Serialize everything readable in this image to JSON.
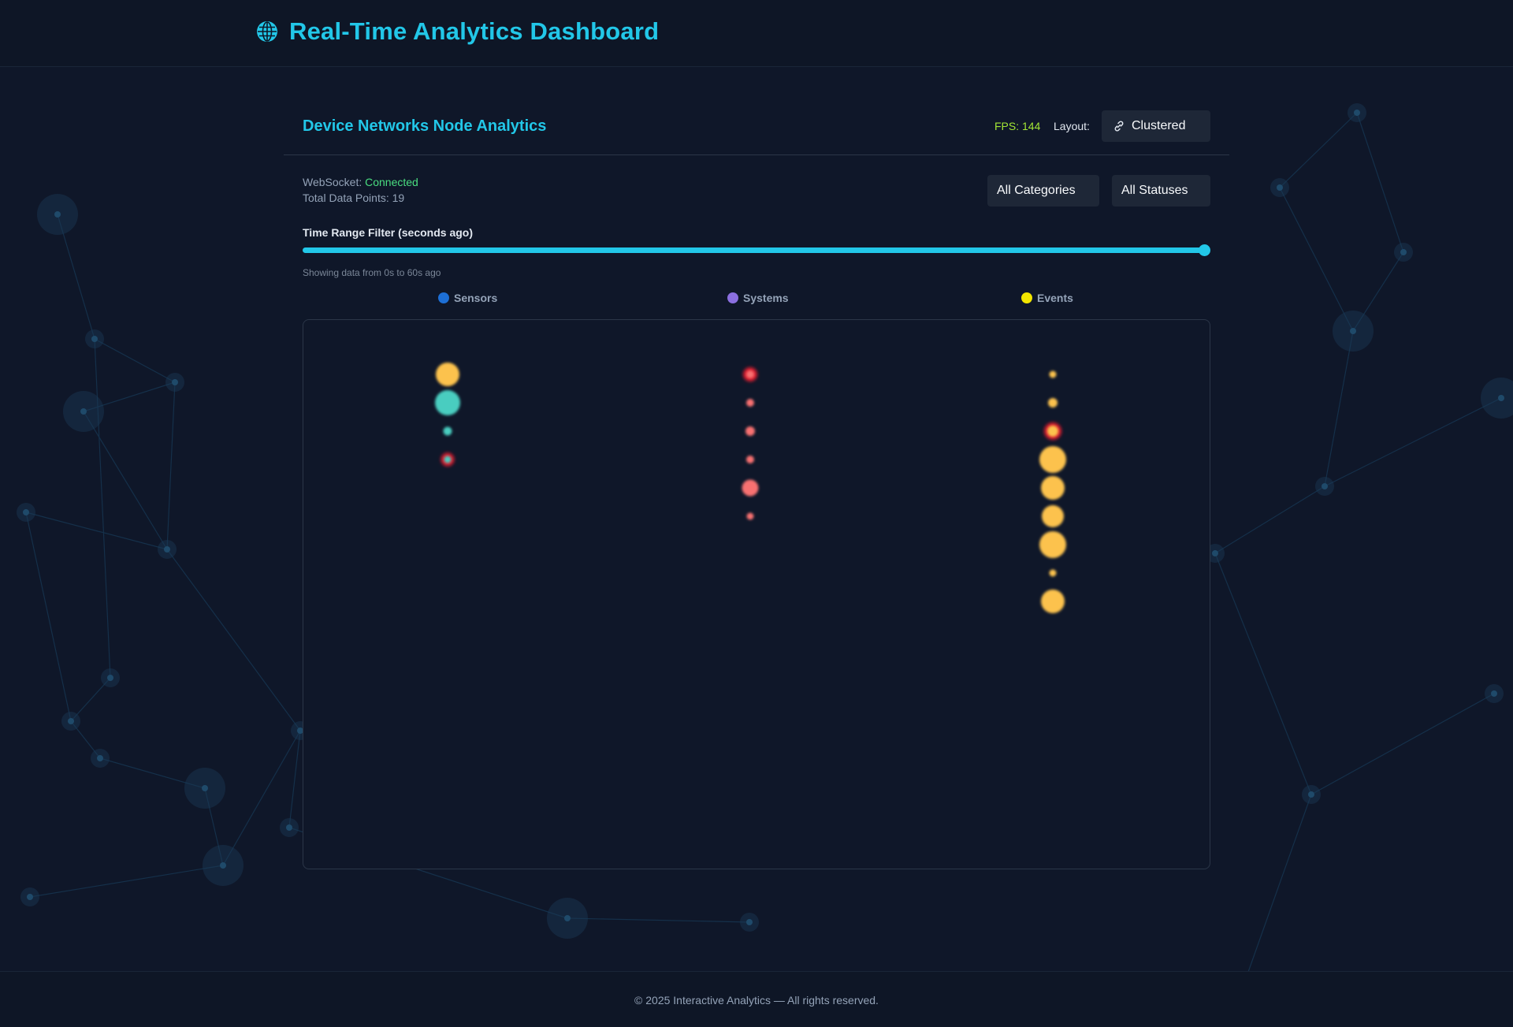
{
  "app": {
    "title": "Real-Time Analytics Dashboard",
    "icon": "globe-icon",
    "accent": "#22c7e8"
  },
  "panel": {
    "title": "Device Networks Node Analytics",
    "fps": "FPS: 144",
    "layout_label": "Layout:",
    "layout_value": "Clustered",
    "layout_icon": "link-icon"
  },
  "status": {
    "websocket_label": "WebSocket: ",
    "websocket_value": "Connected",
    "total_points": "Total Data Points: 19"
  },
  "filters": {
    "category": "All Categories",
    "status": "All Statuses",
    "range_label": "Time Range Filter (seconds ago)",
    "range_value": [
      0,
      60
    ],
    "range_caption": "Showing data from 0s to 60s ago"
  },
  "legend": [
    {
      "label": "Sensors",
      "color": "#1d6fd6"
    },
    {
      "label": "Systems",
      "color": "#8b6fe0"
    },
    {
      "label": "Events",
      "color": "#f2e600"
    }
  ],
  "chart_data": {
    "type": "scatter",
    "columns": [
      "Sensors",
      "Systems",
      "Events"
    ],
    "nodes": [
      {
        "column": "Sensors",
        "row": 0,
        "size": 30,
        "color": "#fcc24d",
        "alert": false
      },
      {
        "column": "Sensors",
        "row": 1,
        "size": 32,
        "color": "#48cdc0",
        "alert": false
      },
      {
        "column": "Sensors",
        "row": 2,
        "size": 11,
        "color": "#48cdc0",
        "alert": false
      },
      {
        "column": "Sensors",
        "row": 3,
        "size": 9,
        "color": "#48cdc0",
        "alert": true
      },
      {
        "column": "Systems",
        "row": 0,
        "size": 10,
        "color": "#f87171",
        "alert": true
      },
      {
        "column": "Systems",
        "row": 1,
        "size": 10,
        "color": "#f87171",
        "alert": false
      },
      {
        "column": "Systems",
        "row": 2,
        "size": 12,
        "color": "#f87171",
        "alert": false
      },
      {
        "column": "Systems",
        "row": 3,
        "size": 10,
        "color": "#f87171",
        "alert": false
      },
      {
        "column": "Systems",
        "row": 4,
        "size": 21,
        "color": "#f87171",
        "alert": false
      },
      {
        "column": "Systems",
        "row": 5,
        "size": 9,
        "color": "#f87171",
        "alert": false
      },
      {
        "column": "Events",
        "row": 0,
        "size": 9,
        "color": "#fcc24d",
        "alert": false
      },
      {
        "column": "Events",
        "row": 1,
        "size": 12,
        "color": "#fcc24d",
        "alert": false
      },
      {
        "column": "Events",
        "row": 2,
        "size": 14,
        "color": "#fcc24d",
        "alert": true
      },
      {
        "column": "Events",
        "row": 3,
        "size": 34,
        "color": "#fcc24d",
        "alert": false
      },
      {
        "column": "Events",
        "row": 4,
        "size": 30,
        "color": "#fcc24d",
        "alert": false
      },
      {
        "column": "Events",
        "row": 5,
        "size": 28,
        "color": "#fcc24d",
        "alert": false
      },
      {
        "column": "Events",
        "row": 6,
        "size": 34,
        "color": "#fcc24d",
        "alert": false
      },
      {
        "column": "Events",
        "row": 7,
        "size": 9,
        "color": "#fcc24d",
        "alert": false
      },
      {
        "column": "Events",
        "row": 8,
        "size": 30,
        "color": "#fcc24d",
        "alert": false
      }
    ]
  },
  "footer": {
    "text": "© 2025 Interactive Analytics — All rights reserved."
  }
}
